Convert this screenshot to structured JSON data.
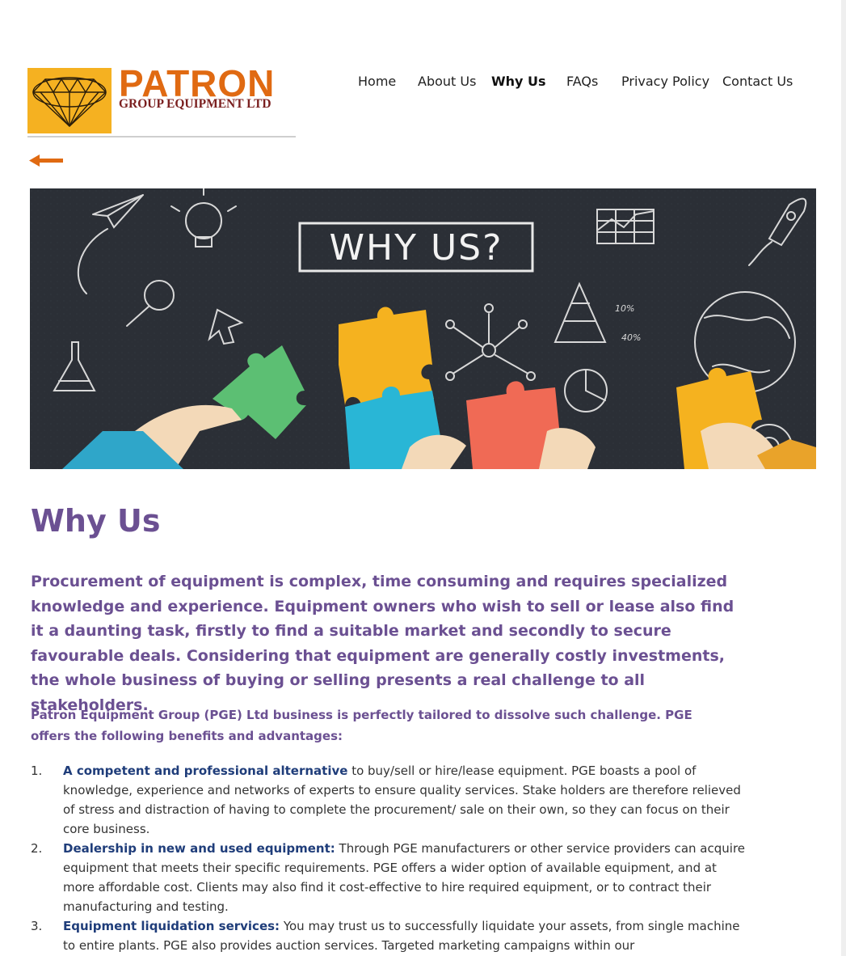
{
  "logo": {
    "title": "PATRON",
    "subtitle": "GROUP EQUIPMENT LTD"
  },
  "nav": {
    "items": [
      {
        "label": "Home",
        "active": false
      },
      {
        "label": "About Us",
        "active": false
      },
      {
        "label": "Why Us",
        "active": true
      },
      {
        "label": "FAQs",
        "active": false
      },
      {
        "label": "Privacy Policy",
        "active": false
      },
      {
        "label": "Contact Us",
        "active": false
      }
    ]
  },
  "back_icon": "left-arrow-icon",
  "banner": {
    "text": "WHY US?",
    "chart_labels": [
      "10%",
      "40%"
    ]
  },
  "content": {
    "heading": "Why Us",
    "lead": "Procurement of equipment is complex, time consuming and requires specialized knowledge and experience. Equipment owners who wish to sell or lease also find it a daunting task, firstly to find a suitable market and secondly to secure favourable deals. Considering that equipment are generally costly investments, the whole business of buying or selling presents a real challenge to all stakeholders.",
    "intro": "Patron Equipment Group (PGE) Ltd business is perfectly tailored to dissolve such challenge. PGE offers the following benefits and advantages:",
    "benefits": [
      {
        "number": "1.",
        "title": "A competent and professional alternative",
        "text": " to buy/sell or hire/lease equipment. PGE boasts a pool of knowledge, experience and networks of experts to ensure quality services. Stake holders are therefore relieved of stress and distraction of having to complete the procurement/ sale on their own, so they can focus on their core business."
      },
      {
        "number": "2.",
        "title": "Dealership in new and used equipment:",
        "text": " Through PGE manufacturers or other service providers can acquire equipment that meets their specific requirements. PGE offers a wider option of available equipment, and at more affordable cost. Clients may also find it cost-effective to hire required equipment, or to contract their manufacturing and testing."
      },
      {
        "number": "3.",
        "title": "Equipment liquidation services:",
        "text": " You may trust us to successfully liquidate your assets, from single machine to entire plants. PGE also provides auction services. Targeted marketing campaigns within our"
      }
    ]
  },
  "colors": {
    "brand_orange": "#e06a12",
    "logo_gold": "#f5b121",
    "heading_purple": "#6b5092",
    "benefit_blue": "#1f3d7a",
    "banner_bg": "#2b2f36"
  }
}
